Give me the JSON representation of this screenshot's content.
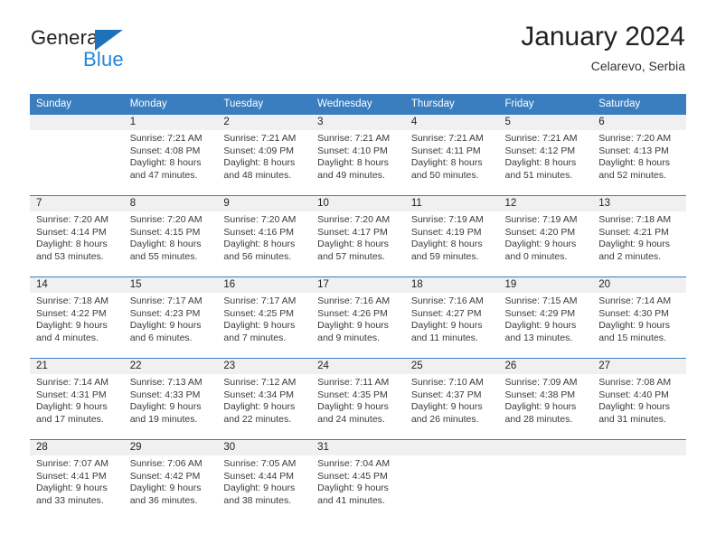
{
  "brand": {
    "word_one": "General",
    "word_two": "Blue",
    "triangle_color": "#1e72bb",
    "blue_text_color": "#2288dd"
  },
  "header": {
    "title": "January 2024",
    "subtitle": "Celarevo, Serbia"
  },
  "theme": {
    "header_bg": "#3b7ebf",
    "header_text": "#ffffff",
    "daynum_band_bg": "#f0f0f0",
    "week_separator": "#3b7ebf",
    "body_text": "#3a3a3a"
  },
  "calendar": {
    "columns": [
      "Sunday",
      "Monday",
      "Tuesday",
      "Wednesday",
      "Thursday",
      "Friday",
      "Saturday"
    ],
    "weeks": [
      [
        {
          "day": "",
          "lines": []
        },
        {
          "day": "1",
          "lines": [
            "Sunrise: 7:21 AM",
            "Sunset: 4:08 PM",
            "Daylight: 8 hours",
            "and 47 minutes."
          ]
        },
        {
          "day": "2",
          "lines": [
            "Sunrise: 7:21 AM",
            "Sunset: 4:09 PM",
            "Daylight: 8 hours",
            "and 48 minutes."
          ]
        },
        {
          "day": "3",
          "lines": [
            "Sunrise: 7:21 AM",
            "Sunset: 4:10 PM",
            "Daylight: 8 hours",
            "and 49 minutes."
          ]
        },
        {
          "day": "4",
          "lines": [
            "Sunrise: 7:21 AM",
            "Sunset: 4:11 PM",
            "Daylight: 8 hours",
            "and 50 minutes."
          ]
        },
        {
          "day": "5",
          "lines": [
            "Sunrise: 7:21 AM",
            "Sunset: 4:12 PM",
            "Daylight: 8 hours",
            "and 51 minutes."
          ]
        },
        {
          "day": "6",
          "lines": [
            "Sunrise: 7:20 AM",
            "Sunset: 4:13 PM",
            "Daylight: 8 hours",
            "and 52 minutes."
          ]
        }
      ],
      [
        {
          "day": "7",
          "lines": [
            "Sunrise: 7:20 AM",
            "Sunset: 4:14 PM",
            "Daylight: 8 hours",
            "and 53 minutes."
          ]
        },
        {
          "day": "8",
          "lines": [
            "Sunrise: 7:20 AM",
            "Sunset: 4:15 PM",
            "Daylight: 8 hours",
            "and 55 minutes."
          ]
        },
        {
          "day": "9",
          "lines": [
            "Sunrise: 7:20 AM",
            "Sunset: 4:16 PM",
            "Daylight: 8 hours",
            "and 56 minutes."
          ]
        },
        {
          "day": "10",
          "lines": [
            "Sunrise: 7:20 AM",
            "Sunset: 4:17 PM",
            "Daylight: 8 hours",
            "and 57 minutes."
          ]
        },
        {
          "day": "11",
          "lines": [
            "Sunrise: 7:19 AM",
            "Sunset: 4:19 PM",
            "Daylight: 8 hours",
            "and 59 minutes."
          ]
        },
        {
          "day": "12",
          "lines": [
            "Sunrise: 7:19 AM",
            "Sunset: 4:20 PM",
            "Daylight: 9 hours",
            "and 0 minutes."
          ]
        },
        {
          "day": "13",
          "lines": [
            "Sunrise: 7:18 AM",
            "Sunset: 4:21 PM",
            "Daylight: 9 hours",
            "and 2 minutes."
          ]
        }
      ],
      [
        {
          "day": "14",
          "lines": [
            "Sunrise: 7:18 AM",
            "Sunset: 4:22 PM",
            "Daylight: 9 hours",
            "and 4 minutes."
          ]
        },
        {
          "day": "15",
          "lines": [
            "Sunrise: 7:17 AM",
            "Sunset: 4:23 PM",
            "Daylight: 9 hours",
            "and 6 minutes."
          ]
        },
        {
          "day": "16",
          "lines": [
            "Sunrise: 7:17 AM",
            "Sunset: 4:25 PM",
            "Daylight: 9 hours",
            "and 7 minutes."
          ]
        },
        {
          "day": "17",
          "lines": [
            "Sunrise: 7:16 AM",
            "Sunset: 4:26 PM",
            "Daylight: 9 hours",
            "and 9 minutes."
          ]
        },
        {
          "day": "18",
          "lines": [
            "Sunrise: 7:16 AM",
            "Sunset: 4:27 PM",
            "Daylight: 9 hours",
            "and 11 minutes."
          ]
        },
        {
          "day": "19",
          "lines": [
            "Sunrise: 7:15 AM",
            "Sunset: 4:29 PM",
            "Daylight: 9 hours",
            "and 13 minutes."
          ]
        },
        {
          "day": "20",
          "lines": [
            "Sunrise: 7:14 AM",
            "Sunset: 4:30 PM",
            "Daylight: 9 hours",
            "and 15 minutes."
          ]
        }
      ],
      [
        {
          "day": "21",
          "lines": [
            "Sunrise: 7:14 AM",
            "Sunset: 4:31 PM",
            "Daylight: 9 hours",
            "and 17 minutes."
          ]
        },
        {
          "day": "22",
          "lines": [
            "Sunrise: 7:13 AM",
            "Sunset: 4:33 PM",
            "Daylight: 9 hours",
            "and 19 minutes."
          ]
        },
        {
          "day": "23",
          "lines": [
            "Sunrise: 7:12 AM",
            "Sunset: 4:34 PM",
            "Daylight: 9 hours",
            "and 22 minutes."
          ]
        },
        {
          "day": "24",
          "lines": [
            "Sunrise: 7:11 AM",
            "Sunset: 4:35 PM",
            "Daylight: 9 hours",
            "and 24 minutes."
          ]
        },
        {
          "day": "25",
          "lines": [
            "Sunrise: 7:10 AM",
            "Sunset: 4:37 PM",
            "Daylight: 9 hours",
            "and 26 minutes."
          ]
        },
        {
          "day": "26",
          "lines": [
            "Sunrise: 7:09 AM",
            "Sunset: 4:38 PM",
            "Daylight: 9 hours",
            "and 28 minutes."
          ]
        },
        {
          "day": "27",
          "lines": [
            "Sunrise: 7:08 AM",
            "Sunset: 4:40 PM",
            "Daylight: 9 hours",
            "and 31 minutes."
          ]
        }
      ],
      [
        {
          "day": "28",
          "lines": [
            "Sunrise: 7:07 AM",
            "Sunset: 4:41 PM",
            "Daylight: 9 hours",
            "and 33 minutes."
          ]
        },
        {
          "day": "29",
          "lines": [
            "Sunrise: 7:06 AM",
            "Sunset: 4:42 PM",
            "Daylight: 9 hours",
            "and 36 minutes."
          ]
        },
        {
          "day": "30",
          "lines": [
            "Sunrise: 7:05 AM",
            "Sunset: 4:44 PM",
            "Daylight: 9 hours",
            "and 38 minutes."
          ]
        },
        {
          "day": "31",
          "lines": [
            "Sunrise: 7:04 AM",
            "Sunset: 4:45 PM",
            "Daylight: 9 hours",
            "and 41 minutes."
          ]
        },
        {
          "day": "",
          "lines": []
        },
        {
          "day": "",
          "lines": []
        },
        {
          "day": "",
          "lines": []
        }
      ]
    ]
  }
}
